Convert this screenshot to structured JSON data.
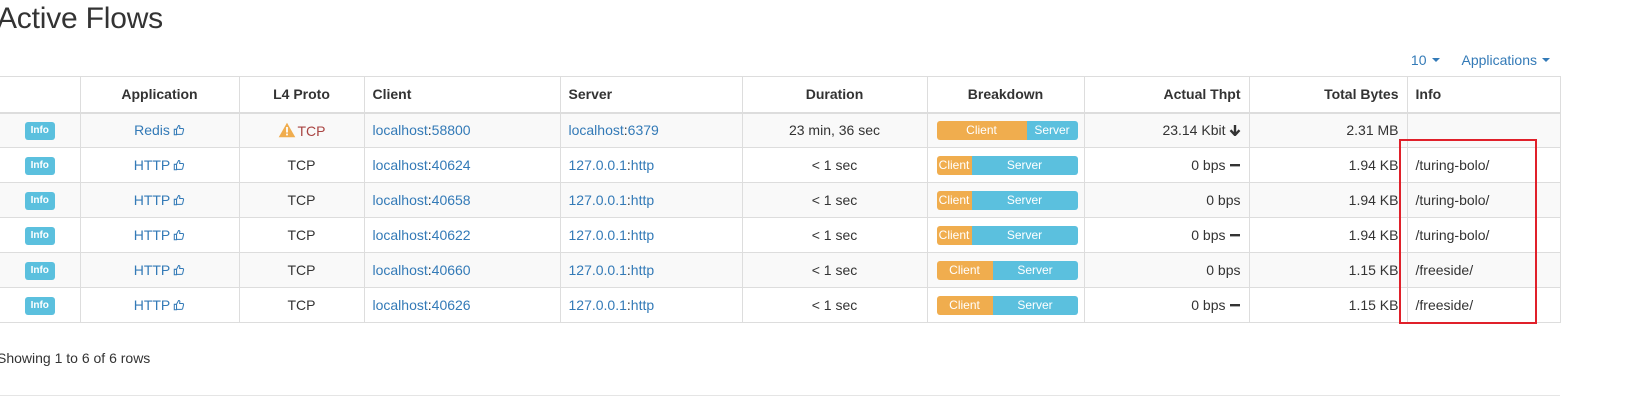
{
  "page": {
    "title": "Active Flows"
  },
  "toolbar": {
    "page_size": "10",
    "filter_label": "Applications"
  },
  "table": {
    "headers": {
      "actions": "",
      "application": "Application",
      "l4proto": "L4 Proto",
      "client": "Client",
      "server": "Server",
      "duration": "Duration",
      "breakdown": "Breakdown",
      "thpt": "Actual Thpt",
      "bytes": "Total Bytes",
      "info": "Info"
    },
    "rows": [
      {
        "info_button": "Info",
        "application": "Redis",
        "l4proto": "TCP",
        "l4proto_warning": true,
        "client_host": "localhost",
        "client_port": "58800",
        "server_host": "localhost",
        "server_port": "6379",
        "duration": "23 min, 36 sec",
        "breakdown_client_label": "Client",
        "breakdown_server_label": "Server",
        "breakdown_client_pct": 64,
        "thpt": "23.14 Kbit",
        "thpt_trend": "down",
        "bytes": "2.31 MB",
        "info": ""
      },
      {
        "info_button": "Info",
        "application": "HTTP",
        "l4proto": "TCP",
        "l4proto_warning": false,
        "client_host": "localhost",
        "client_port": "40624",
        "server_host": "127.0.0.1",
        "server_port": "http",
        "duration": "< 1 sec",
        "breakdown_client_label": "Client",
        "breakdown_server_label": "Server",
        "breakdown_client_pct": 25,
        "thpt": "0 bps",
        "thpt_trend": "flat",
        "bytes": "1.94 KB",
        "info": "/turing-bolo/"
      },
      {
        "info_button": "Info",
        "application": "HTTP",
        "l4proto": "TCP",
        "l4proto_warning": false,
        "client_host": "localhost",
        "client_port": "40658",
        "server_host": "127.0.0.1",
        "server_port": "http",
        "duration": "< 1 sec",
        "breakdown_client_label": "Client",
        "breakdown_server_label": "Server",
        "breakdown_client_pct": 25,
        "thpt": "0 bps",
        "thpt_trend": "none",
        "bytes": "1.94 KB",
        "info": "/turing-bolo/"
      },
      {
        "info_button": "Info",
        "application": "HTTP",
        "l4proto": "TCP",
        "l4proto_warning": false,
        "client_host": "localhost",
        "client_port": "40622",
        "server_host": "127.0.0.1",
        "server_port": "http",
        "duration": "< 1 sec",
        "breakdown_client_label": "Client",
        "breakdown_server_label": "Server",
        "breakdown_client_pct": 25,
        "thpt": "0 bps",
        "thpt_trend": "flat",
        "bytes": "1.94 KB",
        "info": "/turing-bolo/"
      },
      {
        "info_button": "Info",
        "application": "HTTP",
        "l4proto": "TCP",
        "l4proto_warning": false,
        "client_host": "localhost",
        "client_port": "40660",
        "server_host": "127.0.0.1",
        "server_port": "http",
        "duration": "< 1 sec",
        "breakdown_client_label": "Client",
        "breakdown_server_label": "Server",
        "breakdown_client_pct": 40,
        "thpt": "0 bps",
        "thpt_trend": "none",
        "bytes": "1.15 KB",
        "info": "/freeside/"
      },
      {
        "info_button": "Info",
        "application": "HTTP",
        "l4proto": "TCP",
        "l4proto_warning": false,
        "client_host": "localhost",
        "client_port": "40626",
        "server_host": "127.0.0.1",
        "server_port": "http",
        "duration": "< 1 sec",
        "breakdown_client_label": "Client",
        "breakdown_server_label": "Server",
        "breakdown_client_pct": 40,
        "thpt": "0 bps",
        "thpt_trend": "flat",
        "bytes": "1.15 KB",
        "info": "/freeside/"
      }
    ]
  },
  "footer": {
    "pagination_text": "Showing 1 to 6 of 6 rows"
  },
  "icons": {
    "app_icon": "thumbs-up-icon",
    "proto_warning_icon": "warning-icon",
    "trend_down_icon": "arrow-down-icon",
    "trend_flat_icon": "minus-icon"
  },
  "colors": {
    "link": "#337ab7",
    "info_button": "#5bc0de",
    "client_bar": "#f0ad4e",
    "server_bar": "#5bc0de",
    "warning_text": "#a94442",
    "warning_icon": "#f0ad4e",
    "highlight_box": "#e0202a"
  }
}
